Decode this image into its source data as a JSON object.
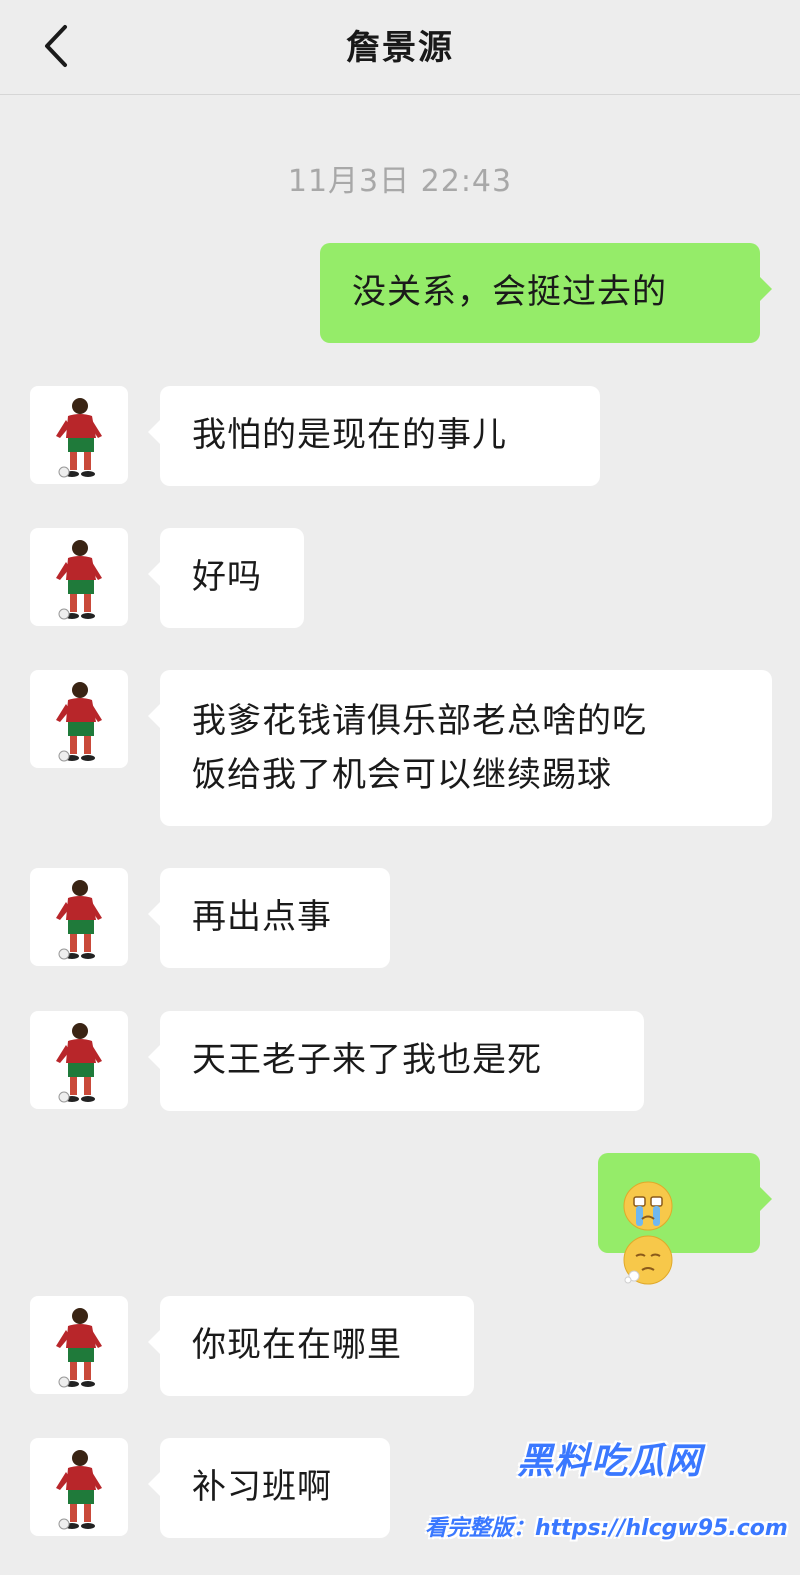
{
  "header": {
    "title": "詹景源",
    "back_icon": "chevron-left-icon"
  },
  "timestamp": "11月3日 22:43",
  "messages": [
    {
      "side": "out",
      "text": "没关系，会挺过去的"
    },
    {
      "side": "in",
      "text": "我怕的是现在的事儿"
    },
    {
      "side": "in",
      "text": "好吗"
    },
    {
      "side": "in",
      "lines": [
        "我爹花钱请俱乐部老总啥的吃",
        "饭给我了机会可以继续踢球"
      ]
    },
    {
      "side": "in",
      "text": "再出点事"
    },
    {
      "side": "in",
      "text": "天王老子来了我也是死"
    },
    {
      "side": "out",
      "emojis": [
        "crying-face-icon",
        "sighing-face-icon"
      ]
    },
    {
      "side": "in",
      "text": "你现在在哪里"
    },
    {
      "side": "in",
      "text": "补习班啊"
    }
  ],
  "avatar_icon": "soccer-player-avatar-icon",
  "watermark": {
    "line1": "黑料吃瓜网",
    "line2": "看完整版：https://hlcgw95.com"
  },
  "colors": {
    "background": "#ededed",
    "outgoing_bubble": "#95ec69",
    "incoming_bubble": "#ffffff",
    "watermark": "#3a78ff"
  }
}
